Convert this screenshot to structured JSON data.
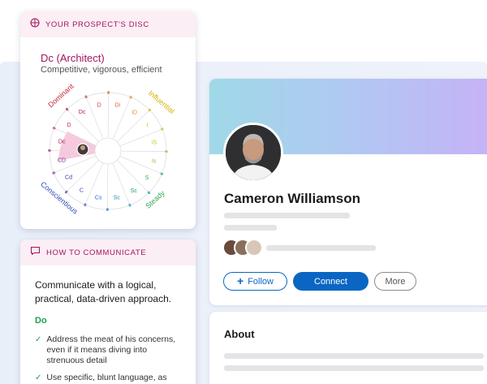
{
  "disc": {
    "header": "YOUR PROSPECT'S DISC",
    "type": "Dc (Architect)",
    "description": "Competitive, vigorous, efficient",
    "wheel": {
      "groups": [
        "Dominant",
        "Influential",
        "Steady",
        "Conscientious"
      ],
      "segments": [
        "D",
        "Di",
        "iD",
        "I",
        "iS",
        "Is",
        "S",
        "Sc",
        "Sc",
        "Cs",
        "C",
        "Cd",
        "CD",
        "Dc",
        "D",
        "Dc"
      ],
      "selected": "Dc"
    }
  },
  "communicate": {
    "header": "HOW TO COMMUNICATE",
    "main": "Communicate with a logical, practical, data-driven approach.",
    "do_label": "Do",
    "do_items": [
      "Address the meat of his concerns, even if it means diving into strenuous detail",
      "Use specific, blunt language, as"
    ]
  },
  "profile": {
    "name": "Cameron Williamson",
    "follow_label": "Follow",
    "connect_label": "Connect",
    "more_label": "More",
    "about_title": "About"
  },
  "colors": {
    "accent": "#a4145f",
    "primary_blue": "#0a66c2",
    "do_green": "#16a34a"
  },
  "icons": {
    "disc_header": "compass-icon",
    "comm_header": "chat-icon",
    "follow": "plus-icon"
  }
}
